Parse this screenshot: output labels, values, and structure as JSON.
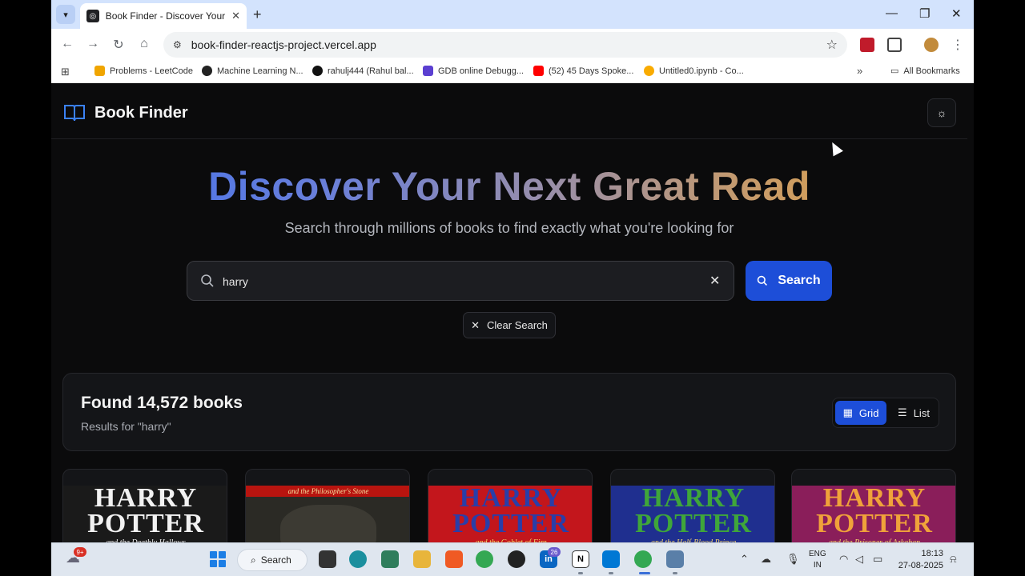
{
  "browser": {
    "tab_title": "Book Finder - Discover Your Next Great Read",
    "url": "book-finder-reactjs-project.vercel.app",
    "bookmarks": [
      {
        "label": "Problems - LeetCode",
        "color": "#f0a500"
      },
      {
        "label": "Machine Learning N...",
        "color": "#222222"
      },
      {
        "label": "rahulj444 (Rahul bal...",
        "color": "#111111"
      },
      {
        "label": "GDB online Debugg...",
        "color": "#5b3fd1"
      },
      {
        "label": "(52) 45 Days Spoke...",
        "color": "#ff0000"
      },
      {
        "label": "Untitled0.ipynb - Co...",
        "color": "#f9ab00"
      }
    ],
    "all_bookmarks": "All Bookmarks"
  },
  "app": {
    "brand": "Book Finder",
    "hero_title": "Discover Your Next Great Read",
    "hero_subtitle": "Search through millions of books to find exactly what you're looking for",
    "search": {
      "value": "harry",
      "button": "Search"
    },
    "clear_button": "Clear Search",
    "results": {
      "title": "Found 14,572 books",
      "subtitle": "Results for \"harry\"",
      "view_grid": "Grid",
      "view_list": "List",
      "active_view": "grid"
    },
    "books": [
      {
        "line1": "HARRY",
        "line2": "POTTER",
        "subtitle": "and the Deathly Hallows",
        "bg": "#1a1a1a",
        "fg": "#f2f2f2"
      },
      {
        "line1": "",
        "line2": "",
        "subtitle": "and the Philosopher's Stone",
        "bg": "#2b2a25",
        "fg": "#e8c77a"
      },
      {
        "line1": "HARRY",
        "line2": "POTTER",
        "subtitle": "and the Goblet of Fire",
        "bg": "#c3161c",
        "fg": "#2a3ea8"
      },
      {
        "line1": "HARRY",
        "line2": "POTTER",
        "subtitle": "and the Half-Blood Prince",
        "bg": "#1f2f8f",
        "fg": "#3fa63a"
      },
      {
        "line1": "HARRY",
        "line2": "POTTER",
        "subtitle": "and the Prisoner of Azkaban",
        "bg": "#8a1e5a",
        "fg": "#f0a23a"
      }
    ]
  },
  "taskbar": {
    "weather_badge": "9+",
    "search_label": "Search",
    "linkedin_badge": "26",
    "language": [
      "ENG",
      "IN"
    ],
    "time": "18:13",
    "date": "27-08-2025"
  }
}
